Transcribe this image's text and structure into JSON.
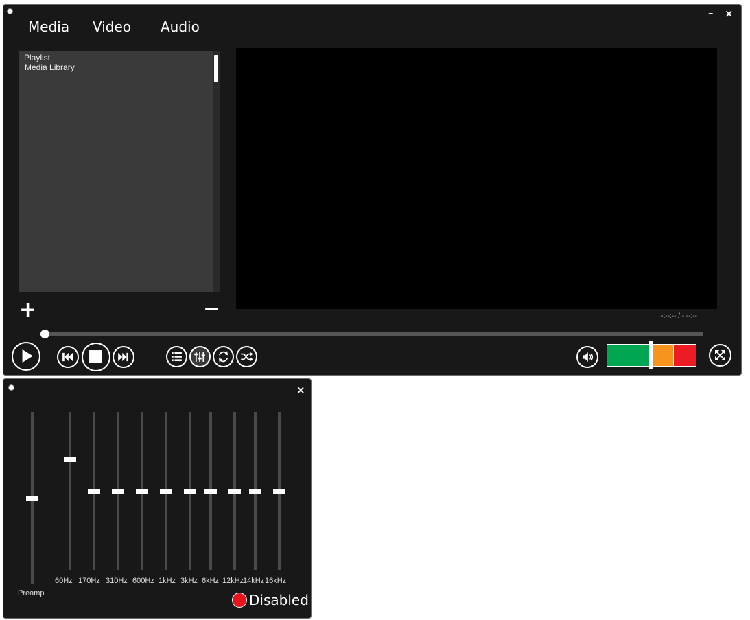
{
  "menu": {
    "media": "Media",
    "video": "Video",
    "audio": "Audio"
  },
  "window_controls": {
    "minimize": "–",
    "close": "×"
  },
  "sidebar": {
    "items": [
      {
        "label": "Playlist"
      },
      {
        "label": "Media Library"
      }
    ],
    "add_label": "+",
    "remove_label": "−"
  },
  "player": {
    "time_display": "-:--:-- / -:--:--",
    "seek_progress": 0
  },
  "volume": {
    "level_fraction": 0.52,
    "zone_colors": [
      "#00a651",
      "#f7941d",
      "#ed1c24"
    ]
  },
  "controls": [
    "play-icon",
    "previous-icon",
    "stop-icon",
    "next-icon",
    "playlist-icon",
    "equalizer-icon",
    "repeat-icon",
    "shuffle-icon",
    "volume-icon",
    "fullscreen-icon"
  ],
  "equalizer": {
    "close_label": "×",
    "preamp": {
      "label": "Preamp",
      "level_fraction": 0.5
    },
    "bands": [
      {
        "label": "60Hz",
        "level_fraction": 0.7
      },
      {
        "label": "170Hz",
        "level_fraction": 0.5
      },
      {
        "label": "310Hz",
        "level_fraction": 0.5
      },
      {
        "label": "600Hz",
        "level_fraction": 0.5
      },
      {
        "label": "1kHz",
        "level_fraction": 0.5
      },
      {
        "label": "3kHz",
        "level_fraction": 0.5
      },
      {
        "label": "6kHz",
        "level_fraction": 0.5
      },
      {
        "label": "12kHz",
        "level_fraction": 0.5
      },
      {
        "label": "14kHz",
        "level_fraction": 0.5
      },
      {
        "label": "16kHz",
        "level_fraction": 0.5
      }
    ],
    "status_label": "Disabled",
    "status_color": "#e8141a"
  }
}
